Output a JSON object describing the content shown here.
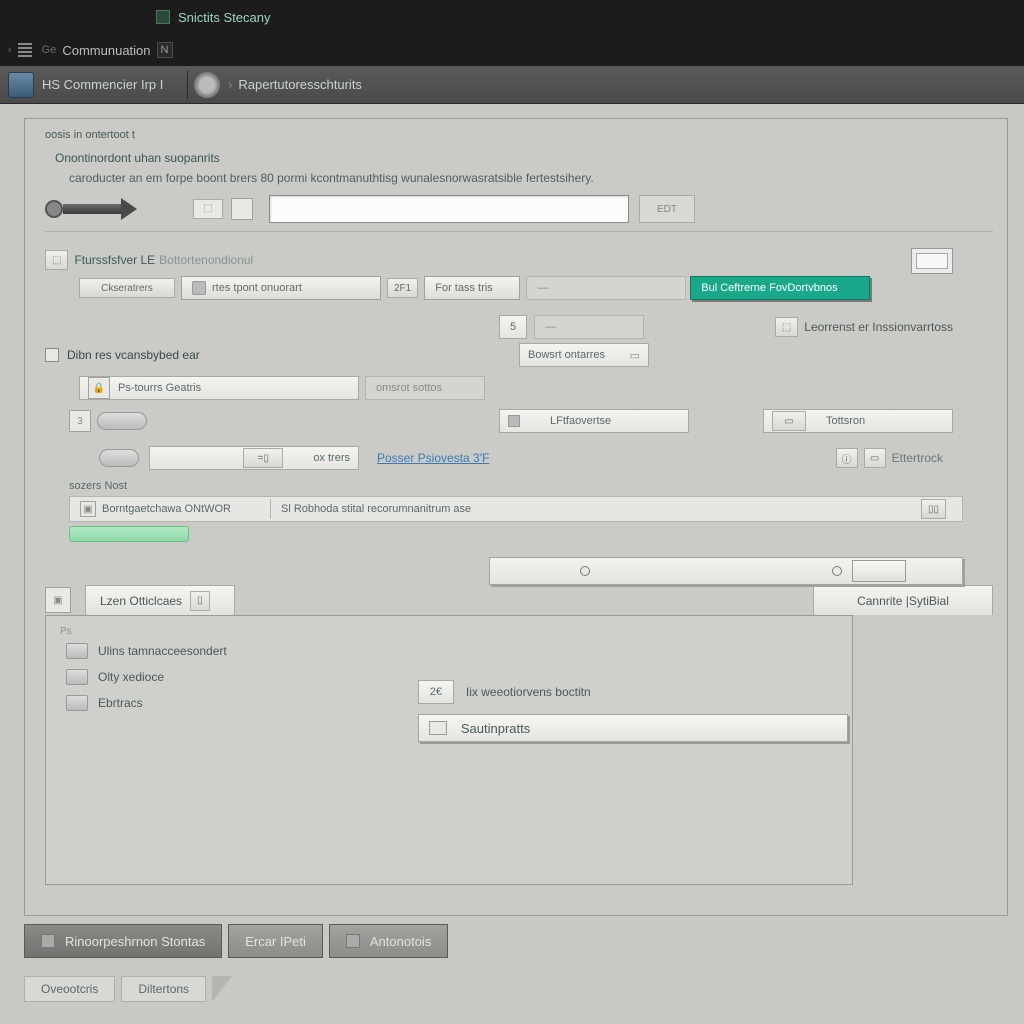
{
  "titlebar": {
    "label": "Snictits Stecany"
  },
  "menubar": {
    "prefix": "Ge",
    "label": "Communuation",
    "tabmark": "N"
  },
  "toolbar": {
    "item1": "HS Commencier Irp I",
    "item2": "Rapertutoresschturits"
  },
  "panel": {
    "title": "oosis in ontertoot t",
    "section1_sub": "Onontinordont uhan suopanrits",
    "section1_desc": "caroducter an em forpe boont brers 80 pormi kcontmanuthtisg wunalesnorwasratsible fertestsihery.",
    "arrow_chip": "⬚",
    "edit_chip": "EDT",
    "group2": {
      "prefix": "Fturssfsfver LE",
      "tail": "Bottortenondionul",
      "chip": "Ckseratrers",
      "btn_a": "rtes tpont onuorart",
      "btn_a_num": "2F1",
      "btn_b": "For tass tris",
      "btn_c": "—",
      "teal": "Bul Ceftrerne FovDortvbnos",
      "side_label": "Leorrenst er Inssionvarrtoss"
    },
    "check_label": "Dibn res vcansbybed ear",
    "float1": {
      "num": "5",
      "label": "—"
    },
    "float2": {
      "label": "Bowsrt ontarres"
    },
    "pill_label": "Ps-tourrs Geatris",
    "pill_side": "omsrot sottos",
    "row_sq": "3",
    "row_mid": "LFtfaovertse",
    "row_right": "Tottsron",
    "cx_label": "ox trers",
    "link": "Posser Psiovesta 3'F",
    "right_label": "Ettertrock",
    "sect": "sozers Nost",
    "barA": "Borntgaetchawa ONtWOR",
    "barB": "Sl Robhoda stital recorumnanitrum ase",
    "tab1": "Lzen Otticlcaes",
    "tab2": "Cannrite  |SytiBial",
    "list": {
      "a": "Ulins tamnacceesondert",
      "b": "Olty xedioce",
      "c": "Ebrtracs"
    },
    "num_chip": "2€",
    "num_label": "Iix weeotiorvens boctitn",
    "expand": "Sautinpratts"
  },
  "footer": {
    "a": "Rinoorpeshrnon Stontas",
    "b": "Ercar IPeti",
    "c": "Antonotois",
    "d": "Oveootcris",
    "e": "Diltertons"
  }
}
